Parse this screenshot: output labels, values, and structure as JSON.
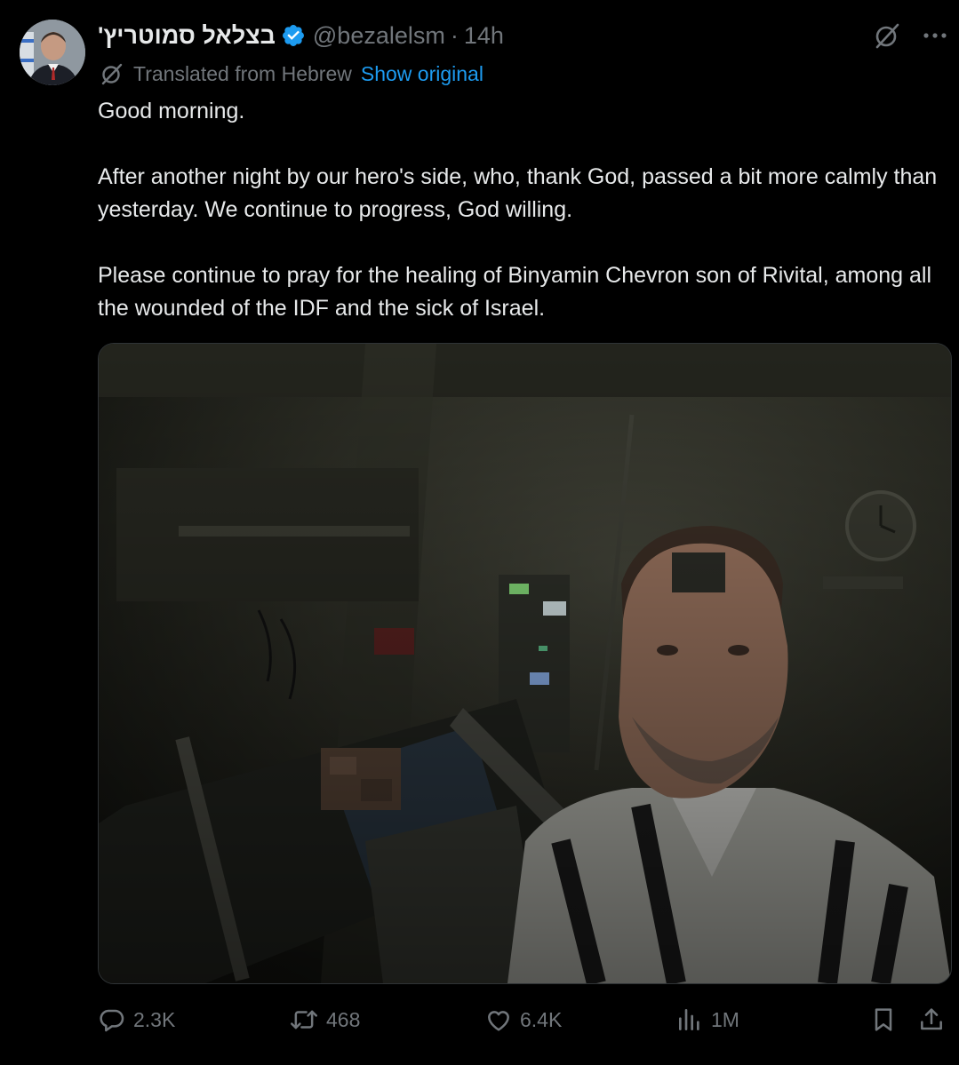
{
  "author": {
    "display_name": "בצלאל סמוטריץ'",
    "handle": "@bezalelsm",
    "separator": "·",
    "time": "14h"
  },
  "translation": {
    "label": "Translated from Hebrew",
    "show_original": "Show original"
  },
  "post": {
    "paragraphs": [
      "Good morning.",
      "After another night by our hero's side, who, thank God, passed a bit more calmly than yesterday. We continue to progress, God willing.",
      "Please continue to pray for the healing of Binyamin Chevron son of Rivital, among all the wounded of the IDF and the sick of Israel."
    ]
  },
  "metrics": {
    "replies": "2.3K",
    "reposts": "468",
    "likes": "6.4K",
    "views": "1M"
  },
  "icons": {
    "reply": "reply-icon",
    "repost": "repost-icon",
    "like": "heart-icon",
    "views": "views-icon",
    "bookmark": "bookmark-icon",
    "share": "share-icon",
    "grok": "grok-icon",
    "more": "more-icon",
    "verified": "verified-badge-icon",
    "translate": "translate-icon"
  },
  "colors": {
    "background": "#000000",
    "text": "#e7e9ea",
    "muted": "#71767b",
    "link": "#1d9bf0",
    "verified": "#1d9bf0"
  }
}
